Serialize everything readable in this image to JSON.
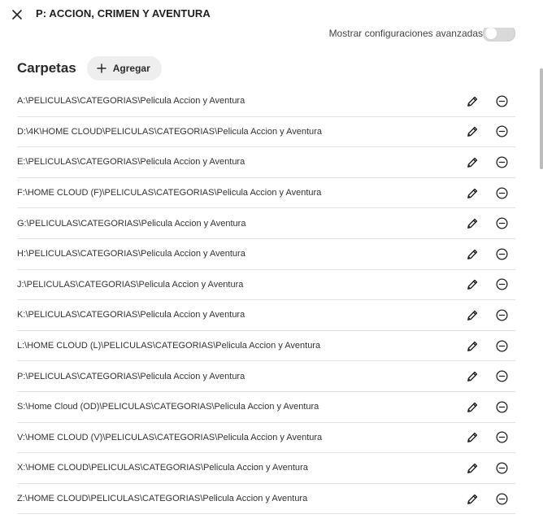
{
  "header": {
    "title": "P: ACCION, CRIMEN Y AVENTURA",
    "close_icon": "close-icon"
  },
  "advanced": {
    "label": "Mostrar configuraciones avanzadas",
    "enabled": false
  },
  "folders": {
    "title": "Carpetas",
    "add_label": "Agregar",
    "add_icon": "plus-icon",
    "items": [
      {
        "path": "A:\\PELICULAS\\CATEGORIAS\\Pelicula Accion y Aventura"
      },
      {
        "path": "D:\\4K\\HOME CLOUD\\PELICULAS\\CATEGORIAS\\Pelicula Accion y Aventura"
      },
      {
        "path": "E:\\PELICULAS\\CATEGORIAS\\Pelicula Accion y Aventura"
      },
      {
        "path": "F:\\HOME CLOUD (F)\\PELICULAS\\CATEGORIAS\\Pelicula Accion y Aventura"
      },
      {
        "path": "G:\\PELICULAS\\CATEGORIAS\\Pelicula Accion y Aventura"
      },
      {
        "path": "H:\\PELICULAS\\CATEGORIAS\\Pelicula Accion y Aventura"
      },
      {
        "path": "J:\\PELICULAS\\CATEGORIAS\\Pelicula Accion y Aventura"
      },
      {
        "path": "K:\\PELICULAS\\CATEGORIAS\\Pelicula Accion y Aventura"
      },
      {
        "path": "L:\\HOME CLOUD (L)\\PELICULAS\\CATEGORIAS\\Pelicula Accion y Aventura"
      },
      {
        "path": "P:\\PELICULAS\\CATEGORIAS\\Pelicula Accion y Aventura"
      },
      {
        "path": "S:\\Home Cloud (OD)\\PELICULAS\\CATEGORIAS\\Pelicula Accion y Aventura"
      },
      {
        "path": "V:\\HOME CLOUD (V)\\PELICULAS\\CATEGORIAS\\Pelicula Accion y Aventura"
      },
      {
        "path": "X:\\HOME CLOUD\\PELICULAS\\CATEGORIAS\\Pelicula Accion y Aventura"
      },
      {
        "path": "Z:\\HOME CLOUD\\PELICULAS\\CATEGORIAS\\Pelicula Accion y Aventura"
      }
    ]
  },
  "icons": {
    "edit": "pencil-icon",
    "remove": "minus-circle-icon"
  },
  "colors": {
    "text": "#1f1f1f",
    "divider": "#e2e2e2",
    "button_bg": "#eeeeef",
    "toggle_off": "#d9d9d9"
  }
}
